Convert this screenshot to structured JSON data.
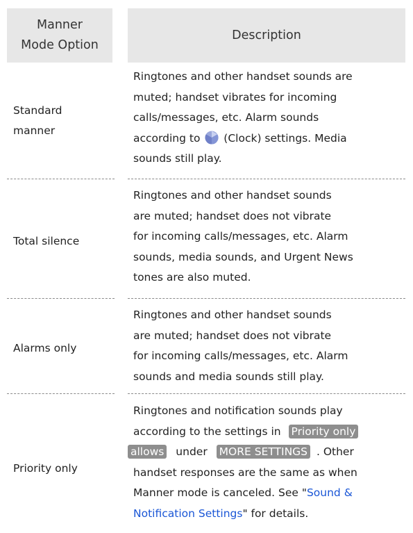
{
  "header": {
    "option_line1": "Manner",
    "option_line2": "Mode Option",
    "description": "Description"
  },
  "rows": [
    {
      "option_line1": "Standard",
      "option_line2": "manner",
      "desc_line1": "Ringtones and other handset sounds are",
      "desc_line2": "muted; handset vibrates for incoming",
      "desc_line3": "calls/messages, etc. Alarm sounds",
      "desc_line4_pre": "according to",
      "desc_line4_post": "(Clock) settings. Media",
      "desc_line5": "sounds still play.",
      "icon": "clock-app-icon"
    },
    {
      "option": "Total silence",
      "desc_line1": "Ringtones and other handset sounds",
      "desc_line2": "are muted; handset does not vibrate",
      "desc_line3": "for incoming calls/messages, etc. Alarm",
      "desc_line4": "sounds, media sounds, and Urgent News",
      "desc_line5": "tones are also muted."
    },
    {
      "option": "Alarms only",
      "desc_line1": "Ringtones and other handset sounds",
      "desc_line2": "are muted; handset does not vibrate",
      "desc_line3": "for incoming calls/messages, etc. Alarm",
      "desc_line4": "sounds and media sounds still play."
    },
    {
      "option": "Priority only",
      "desc_line1": "Ringtones and notification sounds play",
      "desc_line2_pre": "according to the settings in",
      "priority_key_part1": "Priority only",
      "priority_key_part2": "allows",
      "under_text": "under",
      "more_settings_key": "MORE SETTINGS",
      "desc_line3_post": ". Other",
      "desc_line4": "handset responses are the same as when",
      "desc_line5_pre": "Manner mode is canceled. See \"",
      "link_part1": "Sound &",
      "link_part2": "Notification Settings",
      "desc_line6_post": "\" for details."
    }
  ]
}
